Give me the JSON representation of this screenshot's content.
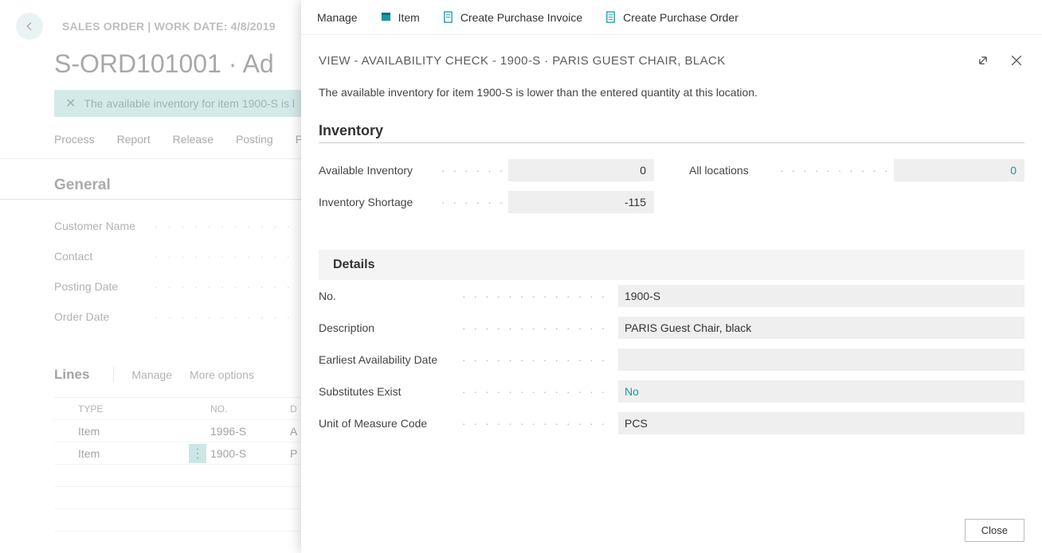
{
  "crumb": "SALES ORDER | WORK DATE: 4/8/2019",
  "page_title": "S-ORD101001 · Ad",
  "notification": "The available inventory for item 1900-S is l",
  "cmdbar": {
    "process": "Process",
    "report": "Report",
    "release": "Release",
    "posting": "Posting",
    "prepare": "P"
  },
  "general": {
    "title": "General",
    "customer_name_lbl": "Customer Name",
    "contact_lbl": "Contact",
    "posting_date_lbl": "Posting Date",
    "order_date_lbl": "Order Date"
  },
  "lines": {
    "title": "Lines",
    "manage": "Manage",
    "more": "More options",
    "hdr_type": "TYPE",
    "hdr_no": "NO.",
    "hdr_d": "D",
    "rows": [
      {
        "type": "Item",
        "no": "1996-S",
        "d": "A",
        "sel": false
      },
      {
        "type": "Item",
        "no": "1900-S",
        "d": "P",
        "sel": true
      }
    ]
  },
  "pane": {
    "actions": {
      "manage": "Manage",
      "item": "Item",
      "cpi": "Create Purchase Invoice",
      "cpo": "Create Purchase Order"
    },
    "subtitle": "VIEW - AVAILABILITY CHECK - 1900-S · PARIS GUEST CHAIR, BLACK",
    "message": "The available inventory for item 1900-S is lower than the entered quantity at this location.",
    "inventory": {
      "title": "Inventory",
      "avail_lbl": "Available Inventory",
      "avail_val": "0",
      "short_lbl": "Inventory Shortage",
      "short_val": "-115",
      "alloc_lbl": "All locations",
      "alloc_val": "0"
    },
    "details": {
      "title": "Details",
      "no_lbl": "No.",
      "no_val": "1900-S",
      "desc_lbl": "Description",
      "desc_val": "PARIS Guest Chair, black",
      "ead_lbl": "Earliest Availability Date",
      "ead_val": "",
      "sub_lbl": "Substitutes Exist",
      "sub_val": "No",
      "uom_lbl": "Unit of Measure Code",
      "uom_val": "PCS"
    },
    "close": "Close"
  }
}
